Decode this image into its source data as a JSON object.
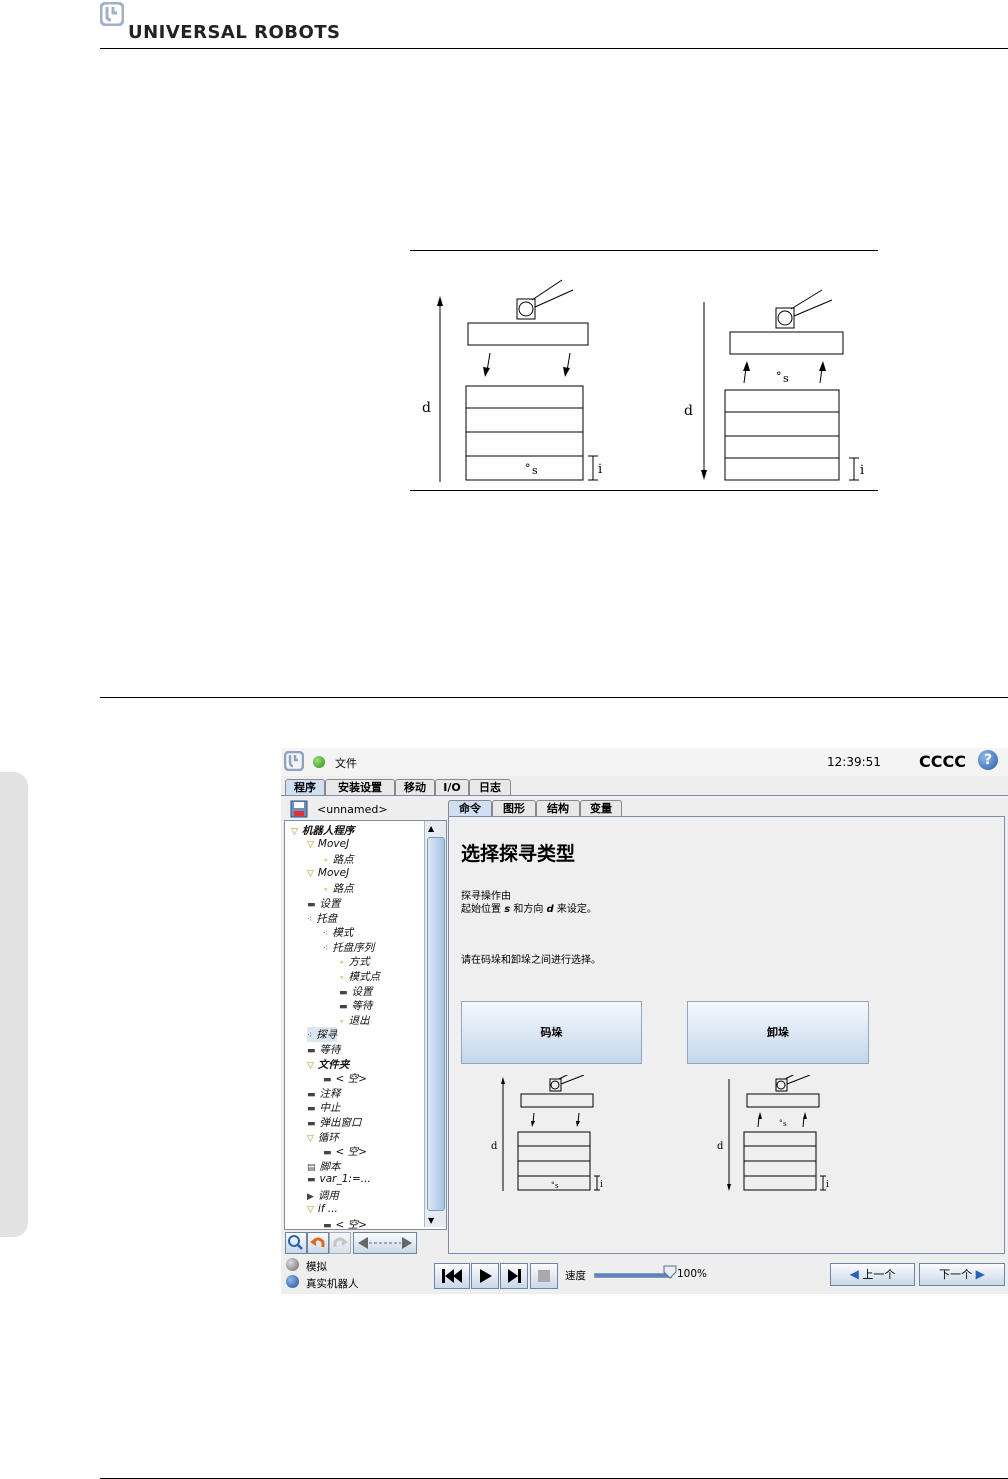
{
  "header": {
    "brand": "UNIVERSAL ROBOTS"
  },
  "top_diagram": {
    "left": {
      "d": "d",
      "s": "s",
      "i": "i"
    },
    "right": {
      "d": "d",
      "s": "s",
      "i": "i"
    }
  },
  "ui": {
    "file_menu": "文件",
    "time": "12:39:51",
    "robot_name": "CCCC",
    "help": "?",
    "main_tabs": [
      "程序",
      "安装设置",
      "移动",
      "I/O",
      "日志"
    ],
    "program_name": "<unnamed>",
    "sub_tabs": [
      "命令",
      "图形",
      "结构",
      "变量"
    ],
    "tree": [
      {
        "label": "机器人程序",
        "indent": 0,
        "icon": "▽",
        "bold": true
      },
      {
        "label": "MoveJ",
        "indent": 1,
        "icon": "▽"
      },
      {
        "label": "路点",
        "indent": 2,
        "icon": "∘"
      },
      {
        "label": "MoveJ",
        "indent": 1,
        "icon": "▽"
      },
      {
        "label": "路点",
        "indent": 2,
        "icon": "∘"
      },
      {
        "label": "设置",
        "indent": 1,
        "icon": "▬"
      },
      {
        "label": "托盘",
        "indent": 1,
        "icon": "⁖"
      },
      {
        "label": "模式",
        "indent": 2,
        "icon": "⁖"
      },
      {
        "label": "托盘序列",
        "indent": 2,
        "icon": "⁖"
      },
      {
        "label": "方式",
        "indent": 3,
        "icon": "∘"
      },
      {
        "label": "模式点",
        "indent": 3,
        "icon": "∘"
      },
      {
        "label": "设置",
        "indent": 3,
        "icon": "▬"
      },
      {
        "label": "等待",
        "indent": 3,
        "icon": "▬"
      },
      {
        "label": "退出",
        "indent": 3,
        "icon": "∘"
      },
      {
        "label": "探寻",
        "indent": 1,
        "icon": "⁖",
        "selected": true
      },
      {
        "label": "等待",
        "indent": 1,
        "icon": "▬"
      },
      {
        "label": "文件夹",
        "indent": 1,
        "icon": "▽",
        "bold": true
      },
      {
        "label": "< 空>",
        "indent": 2,
        "icon": "▬"
      },
      {
        "label": "注释",
        "indent": 1,
        "icon": "▬"
      },
      {
        "label": "中止",
        "indent": 1,
        "icon": "▬"
      },
      {
        "label": "弹出窗口",
        "indent": 1,
        "icon": "▬"
      },
      {
        "label": "循环",
        "indent": 1,
        "icon": "▽"
      },
      {
        "label": "< 空>",
        "indent": 2,
        "icon": "▬"
      },
      {
        "label": "脚本",
        "indent": 1,
        "icon": "▤"
      },
      {
        "label": "var_1:=...",
        "indent": 1,
        "icon": "▬"
      },
      {
        "label": "调用",
        "indent": 1,
        "icon": "▶"
      },
      {
        "label": "if ...",
        "indent": 1,
        "icon": "▽"
      },
      {
        "label": "< 空>",
        "indent": 2,
        "icon": "▬"
      }
    ],
    "content": {
      "title": "选择探寻类型",
      "desc_line1": "探寻操作由",
      "desc_line2_a": "起始位置",
      "desc_line2_s": "s",
      "desc_line2_b": "和方向",
      "desc_line2_d": "d",
      "desc_line2_c": "来设定。",
      "instruction": "请在码垛和卸垛之间进行选择。",
      "stack_button": "码垛",
      "destack_button": "卸垛"
    },
    "bottom": {
      "simulate": "模拟",
      "real_robot": "真实机器人",
      "speed_label": "速度",
      "speed_value": "100%",
      "speed_fraction": 1.0,
      "prev_button": "上一个",
      "next_button": "下一个"
    }
  }
}
